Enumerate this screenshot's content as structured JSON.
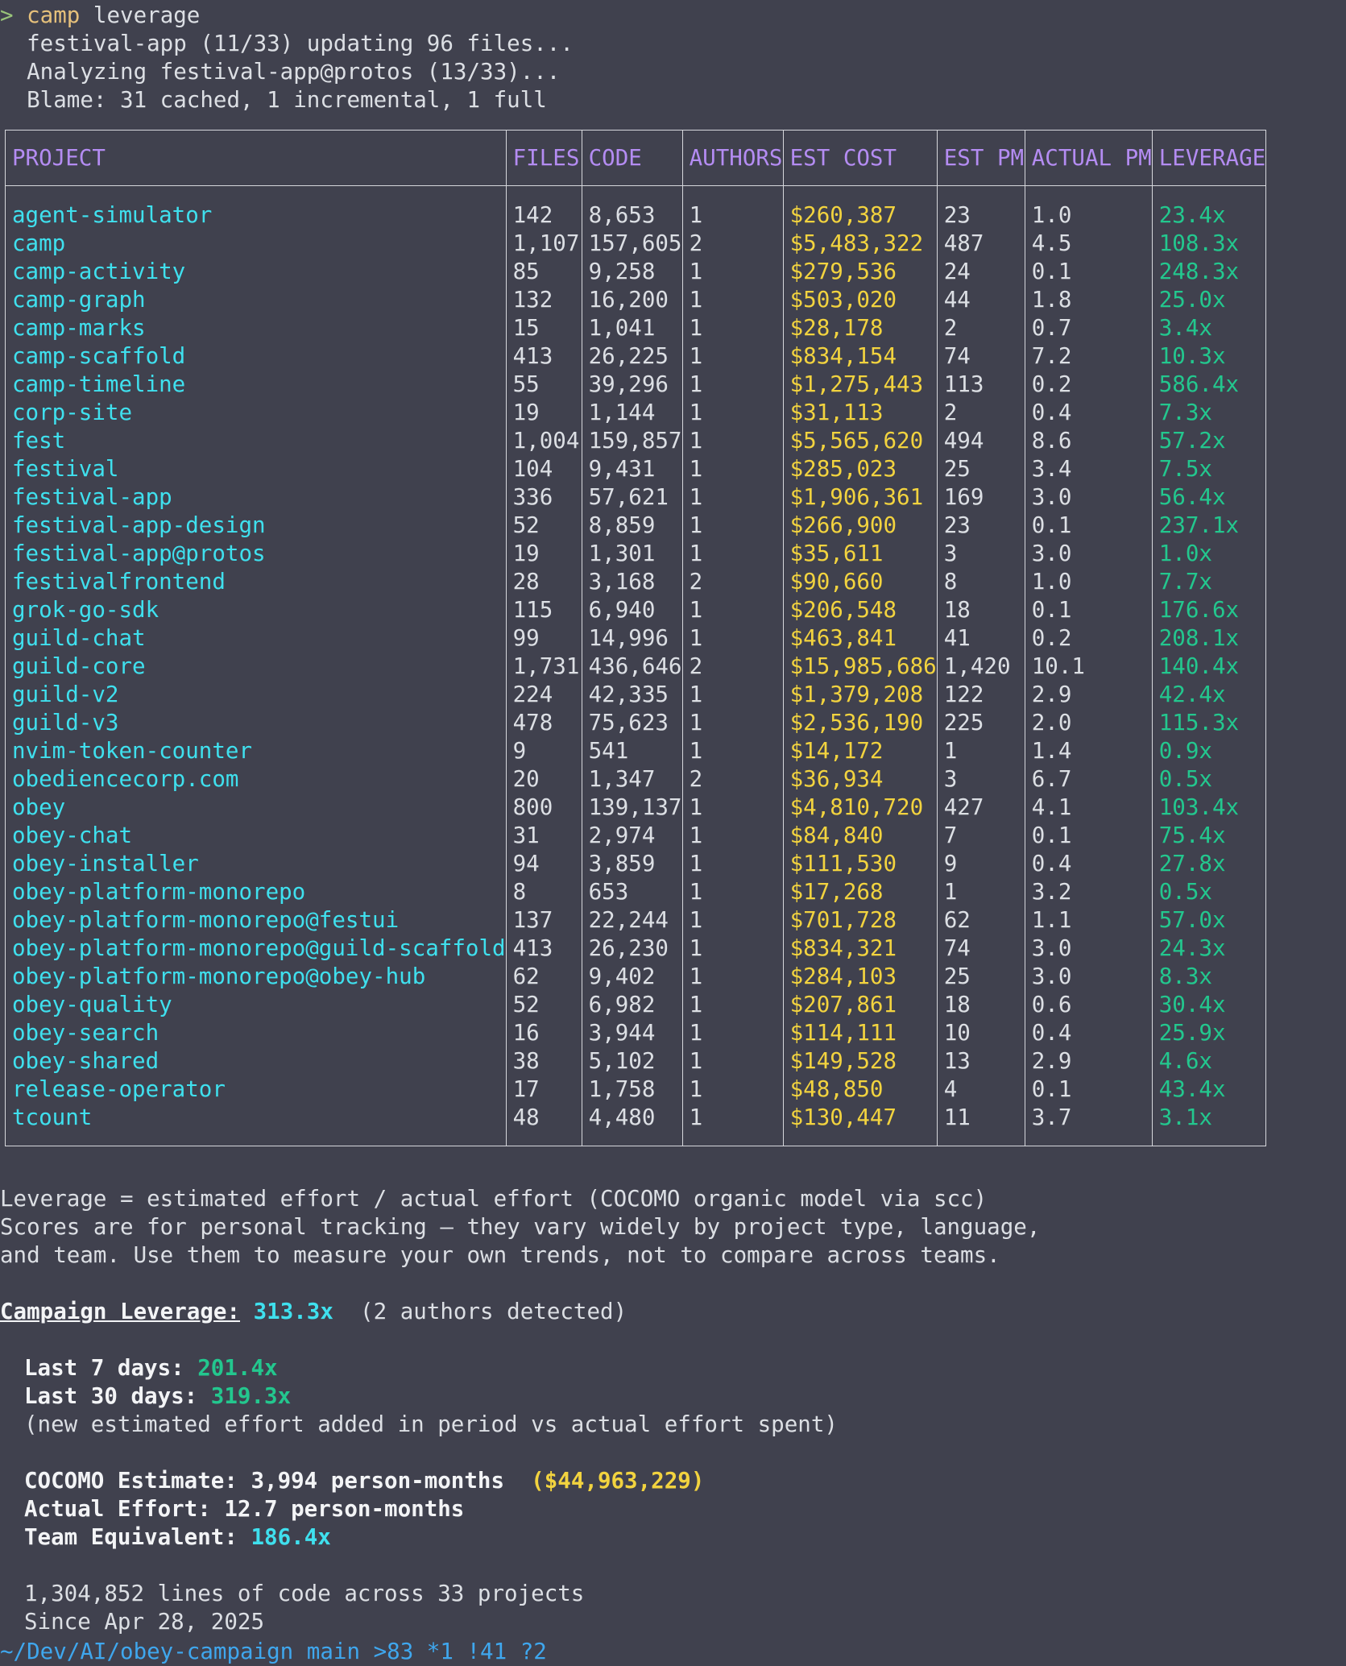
{
  "terminal": {
    "prompt_symbol": ">",
    "command_name": "camp",
    "command_args": " leverage",
    "progress_lines": [
      "  festival-app (11/33) updating 96 files...",
      "  Analyzing festival-app@protos (13/33)...",
      "  Blame: 31 cached, 1 incremental, 1 full"
    ]
  },
  "table": {
    "headers": [
      "PROJECT",
      "FILES",
      "CODE",
      "AUTHORS",
      "EST COST",
      "EST PM",
      "ACTUAL PM",
      "LEVERAGE"
    ],
    "rows": [
      [
        "agent-simulator",
        "142",
        "8,653",
        "1",
        "$260,387",
        "23",
        "1.0",
        "23.4x"
      ],
      [
        "camp",
        "1,107",
        "157,605",
        "2",
        "$5,483,322",
        "487",
        "4.5",
        "108.3x"
      ],
      [
        "camp-activity",
        "85",
        "9,258",
        "1",
        "$279,536",
        "24",
        "0.1",
        "248.3x"
      ],
      [
        "camp-graph",
        "132",
        "16,200",
        "1",
        "$503,020",
        "44",
        "1.8",
        "25.0x"
      ],
      [
        "camp-marks",
        "15",
        "1,041",
        "1",
        "$28,178",
        "2",
        "0.7",
        "3.4x"
      ],
      [
        "camp-scaffold",
        "413",
        "26,225",
        "1",
        "$834,154",
        "74",
        "7.2",
        "10.3x"
      ],
      [
        "camp-timeline",
        "55",
        "39,296",
        "1",
        "$1,275,443",
        "113",
        "0.2",
        "586.4x"
      ],
      [
        "corp-site",
        "19",
        "1,144",
        "1",
        "$31,113",
        "2",
        "0.4",
        "7.3x"
      ],
      [
        "fest",
        "1,004",
        "159,857",
        "1",
        "$5,565,620",
        "494",
        "8.6",
        "57.2x"
      ],
      [
        "festival",
        "104",
        "9,431",
        "1",
        "$285,023",
        "25",
        "3.4",
        "7.5x"
      ],
      [
        "festival-app",
        "336",
        "57,621",
        "1",
        "$1,906,361",
        "169",
        "3.0",
        "56.4x"
      ],
      [
        "festival-app-design",
        "52",
        "8,859",
        "1",
        "$266,900",
        "23",
        "0.1",
        "237.1x"
      ],
      [
        "festival-app@protos",
        "19",
        "1,301",
        "1",
        "$35,611",
        "3",
        "3.0",
        "1.0x"
      ],
      [
        "festivalfrontend",
        "28",
        "3,168",
        "2",
        "$90,660",
        "8",
        "1.0",
        "7.7x"
      ],
      [
        "grok-go-sdk",
        "115",
        "6,940",
        "1",
        "$206,548",
        "18",
        "0.1",
        "176.6x"
      ],
      [
        "guild-chat",
        "99",
        "14,996",
        "1",
        "$463,841",
        "41",
        "0.2",
        "208.1x"
      ],
      [
        "guild-core",
        "1,731",
        "436,646",
        "2",
        "$15,985,686",
        "1,420",
        "10.1",
        "140.4x"
      ],
      [
        "guild-v2",
        "224",
        "42,335",
        "1",
        "$1,379,208",
        "122",
        "2.9",
        "42.4x"
      ],
      [
        "guild-v3",
        "478",
        "75,623",
        "1",
        "$2,536,190",
        "225",
        "2.0",
        "115.3x"
      ],
      [
        "nvim-token-counter",
        "9",
        "541",
        "1",
        "$14,172",
        "1",
        "1.4",
        "0.9x"
      ],
      [
        "obediencecorp.com",
        "20",
        "1,347",
        "2",
        "$36,934",
        "3",
        "6.7",
        "0.5x"
      ],
      [
        "obey",
        "800",
        "139,137",
        "1",
        "$4,810,720",
        "427",
        "4.1",
        "103.4x"
      ],
      [
        "obey-chat",
        "31",
        "2,974",
        "1",
        "$84,840",
        "7",
        "0.1",
        "75.4x"
      ],
      [
        "obey-installer",
        "94",
        "3,859",
        "1",
        "$111,530",
        "9",
        "0.4",
        "27.8x"
      ],
      [
        "obey-platform-monorepo",
        "8",
        "653",
        "1",
        "$17,268",
        "1",
        "3.2",
        "0.5x"
      ],
      [
        "obey-platform-monorepo@festui",
        "137",
        "22,244",
        "1",
        "$701,728",
        "62",
        "1.1",
        "57.0x"
      ],
      [
        "obey-platform-monorepo@guild-scaffold",
        "413",
        "26,230",
        "1",
        "$834,321",
        "74",
        "3.0",
        "24.3x"
      ],
      [
        "obey-platform-monorepo@obey-hub",
        "62",
        "9,402",
        "1",
        "$284,103",
        "25",
        "3.0",
        "8.3x"
      ],
      [
        "obey-quality",
        "52",
        "6,982",
        "1",
        "$207,861",
        "18",
        "0.6",
        "30.4x"
      ],
      [
        "obey-search",
        "16",
        "3,944",
        "1",
        "$114,111",
        "10",
        "0.4",
        "25.9x"
      ],
      [
        "obey-shared",
        "38",
        "5,102",
        "1",
        "$149,528",
        "13",
        "2.9",
        "4.6x"
      ],
      [
        "release-operator",
        "17",
        "1,758",
        "1",
        "$48,850",
        "4",
        "0.1",
        "43.4x"
      ],
      [
        "tcount",
        "48",
        "4,480",
        "1",
        "$130,447",
        "11",
        "3.7",
        "3.1x"
      ]
    ]
  },
  "summary": {
    "explanation": [
      "Leverage = estimated effort / actual effort (COCOMO organic model via scc)",
      "Scores are for personal tracking — they vary widely by project type, language,",
      "and team. Use them to measure your own trends, not to compare across teams."
    ],
    "campaign_label": "Campaign Leverage:",
    "campaign_value": "313.3x",
    "campaign_note": "  (2 authors detected)",
    "last7_label": "Last 7 days:",
    "last7_value": "201.4x",
    "last30_label": "Last 30 days:",
    "last30_value": "319.3x",
    "period_note": "(new estimated effort added in period vs actual effort spent)",
    "cocomo_label": "COCOMO Estimate: 3,994 person-months",
    "cocomo_cost": "($44,963,229)",
    "actual_label": "Actual Effort: 12.7 person-months",
    "team_label": "Team Equivalent:",
    "team_value": "186.4x",
    "lines_total": "1,304,852 lines of code across 33 projects",
    "since": "Since Apr 28, 2025",
    "status_path": "~/Dev/AI/obey-campaign main >83 *1 !41 ?2"
  }
}
